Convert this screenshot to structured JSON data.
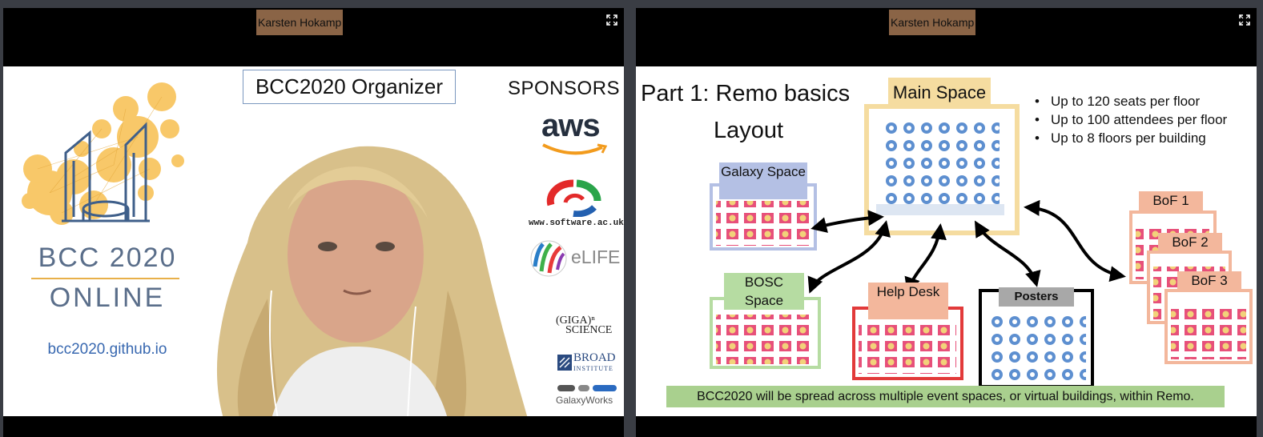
{
  "participants": [
    {
      "name": "Karsten Hokamp"
    },
    {
      "name": "Karsten Hokamp"
    }
  ],
  "left_slide": {
    "logo_title": "BCC 2020",
    "logo_subtitle": "ONLINE",
    "url": "bcc2020.github.io",
    "organizer_label": "BCC2020 Organizer",
    "sponsors_heading": "SPONSORS",
    "sponsor_aws": "aws",
    "sponsor_software_url": "www.software.ac.uk",
    "sponsor_elife": "eLIFE",
    "sponsor_gigascience_1": "(GIGA)ⁿ",
    "sponsor_gigascience_2": "SCIENCE",
    "sponsor_broad": "BROAD",
    "sponsor_broad_sub": "INSTITUTE",
    "sponsor_galaxyworks": "GalaxyWorks"
  },
  "right_slide": {
    "title": "Part 1: Remo basics",
    "subtitle": "Layout",
    "bullets": [
      "Up to 120 seats per floor",
      "Up to 100 attendees per floor",
      "Up to 8 floors per building"
    ],
    "spaces": {
      "main": "Main Space",
      "galaxy": "Galaxy Space",
      "bosc": "BOSC Space",
      "help": "Help Desk",
      "posters": "Posters",
      "bof1": "BoF 1",
      "bof2": "BoF 2",
      "bof3": "BoF 3"
    },
    "banner": "BCC2020 will be spread across multiple event spaces, or virtual buildings, within Remo."
  },
  "colors": {
    "name_tag": "#8a6446",
    "main_space": "#f5dca0",
    "galaxy_space": "#b4c0e4",
    "bosc_space": "#b6dca2",
    "help_desk": "#f3b79c",
    "posters": "#a8a8a8",
    "bof": "#f3b79c",
    "banner": "#a9d08e"
  }
}
